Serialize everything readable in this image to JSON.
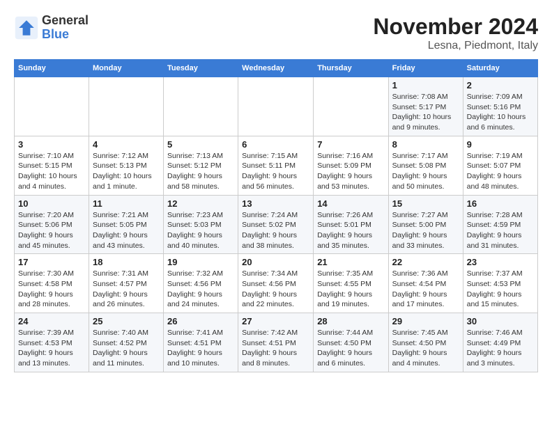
{
  "logo": {
    "text_general": "General",
    "text_blue": "Blue"
  },
  "title": "November 2024",
  "subtitle": "Lesna, Piedmont, Italy",
  "weekdays": [
    "Sunday",
    "Monday",
    "Tuesday",
    "Wednesday",
    "Thursday",
    "Friday",
    "Saturday"
  ],
  "weeks": [
    [
      {
        "day": "",
        "info": ""
      },
      {
        "day": "",
        "info": ""
      },
      {
        "day": "",
        "info": ""
      },
      {
        "day": "",
        "info": ""
      },
      {
        "day": "",
        "info": ""
      },
      {
        "day": "1",
        "info": "Sunrise: 7:08 AM\nSunset: 5:17 PM\nDaylight: 10 hours\nand 9 minutes."
      },
      {
        "day": "2",
        "info": "Sunrise: 7:09 AM\nSunset: 5:16 PM\nDaylight: 10 hours\nand 6 minutes."
      }
    ],
    [
      {
        "day": "3",
        "info": "Sunrise: 7:10 AM\nSunset: 5:15 PM\nDaylight: 10 hours\nand 4 minutes."
      },
      {
        "day": "4",
        "info": "Sunrise: 7:12 AM\nSunset: 5:13 PM\nDaylight: 10 hours\nand 1 minute."
      },
      {
        "day": "5",
        "info": "Sunrise: 7:13 AM\nSunset: 5:12 PM\nDaylight: 9 hours\nand 58 minutes."
      },
      {
        "day": "6",
        "info": "Sunrise: 7:15 AM\nSunset: 5:11 PM\nDaylight: 9 hours\nand 56 minutes."
      },
      {
        "day": "7",
        "info": "Sunrise: 7:16 AM\nSunset: 5:09 PM\nDaylight: 9 hours\nand 53 minutes."
      },
      {
        "day": "8",
        "info": "Sunrise: 7:17 AM\nSunset: 5:08 PM\nDaylight: 9 hours\nand 50 minutes."
      },
      {
        "day": "9",
        "info": "Sunrise: 7:19 AM\nSunset: 5:07 PM\nDaylight: 9 hours\nand 48 minutes."
      }
    ],
    [
      {
        "day": "10",
        "info": "Sunrise: 7:20 AM\nSunset: 5:06 PM\nDaylight: 9 hours\nand 45 minutes."
      },
      {
        "day": "11",
        "info": "Sunrise: 7:21 AM\nSunset: 5:05 PM\nDaylight: 9 hours\nand 43 minutes."
      },
      {
        "day": "12",
        "info": "Sunrise: 7:23 AM\nSunset: 5:03 PM\nDaylight: 9 hours\nand 40 minutes."
      },
      {
        "day": "13",
        "info": "Sunrise: 7:24 AM\nSunset: 5:02 PM\nDaylight: 9 hours\nand 38 minutes."
      },
      {
        "day": "14",
        "info": "Sunrise: 7:26 AM\nSunset: 5:01 PM\nDaylight: 9 hours\nand 35 minutes."
      },
      {
        "day": "15",
        "info": "Sunrise: 7:27 AM\nSunset: 5:00 PM\nDaylight: 9 hours\nand 33 minutes."
      },
      {
        "day": "16",
        "info": "Sunrise: 7:28 AM\nSunset: 4:59 PM\nDaylight: 9 hours\nand 31 minutes."
      }
    ],
    [
      {
        "day": "17",
        "info": "Sunrise: 7:30 AM\nSunset: 4:58 PM\nDaylight: 9 hours\nand 28 minutes."
      },
      {
        "day": "18",
        "info": "Sunrise: 7:31 AM\nSunset: 4:57 PM\nDaylight: 9 hours\nand 26 minutes."
      },
      {
        "day": "19",
        "info": "Sunrise: 7:32 AM\nSunset: 4:56 PM\nDaylight: 9 hours\nand 24 minutes."
      },
      {
        "day": "20",
        "info": "Sunrise: 7:34 AM\nSunset: 4:56 PM\nDaylight: 9 hours\nand 22 minutes."
      },
      {
        "day": "21",
        "info": "Sunrise: 7:35 AM\nSunset: 4:55 PM\nDaylight: 9 hours\nand 19 minutes."
      },
      {
        "day": "22",
        "info": "Sunrise: 7:36 AM\nSunset: 4:54 PM\nDaylight: 9 hours\nand 17 minutes."
      },
      {
        "day": "23",
        "info": "Sunrise: 7:37 AM\nSunset: 4:53 PM\nDaylight: 9 hours\nand 15 minutes."
      }
    ],
    [
      {
        "day": "24",
        "info": "Sunrise: 7:39 AM\nSunset: 4:53 PM\nDaylight: 9 hours\nand 13 minutes."
      },
      {
        "day": "25",
        "info": "Sunrise: 7:40 AM\nSunset: 4:52 PM\nDaylight: 9 hours\nand 11 minutes."
      },
      {
        "day": "26",
        "info": "Sunrise: 7:41 AM\nSunset: 4:51 PM\nDaylight: 9 hours\nand 10 minutes."
      },
      {
        "day": "27",
        "info": "Sunrise: 7:42 AM\nSunset: 4:51 PM\nDaylight: 9 hours\nand 8 minutes."
      },
      {
        "day": "28",
        "info": "Sunrise: 7:44 AM\nSunset: 4:50 PM\nDaylight: 9 hours\nand 6 minutes."
      },
      {
        "day": "29",
        "info": "Sunrise: 7:45 AM\nSunset: 4:50 PM\nDaylight: 9 hours\nand 4 minutes."
      },
      {
        "day": "30",
        "info": "Sunrise: 7:46 AM\nSunset: 4:49 PM\nDaylight: 9 hours\nand 3 minutes."
      }
    ]
  ]
}
